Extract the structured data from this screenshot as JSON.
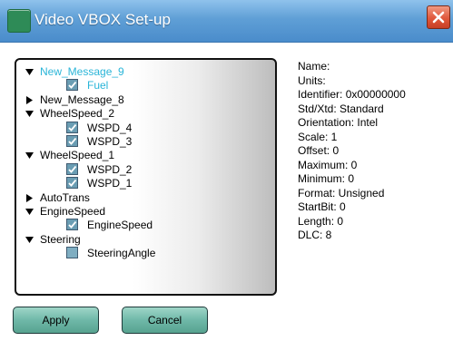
{
  "window": {
    "title": "Video VBOX Set-up"
  },
  "tree": {
    "nodes": [
      {
        "label": "New_Message_9",
        "expanded": true,
        "selected": true,
        "children": [
          {
            "label": "Fuel",
            "checked": true,
            "selected": true
          }
        ]
      },
      {
        "label": "New_Message_8",
        "expanded": false,
        "children": []
      },
      {
        "label": "WheelSpeed_2",
        "expanded": true,
        "children": [
          {
            "label": "WSPD_4",
            "checked": true
          },
          {
            "label": "WSPD_3",
            "checked": true
          }
        ]
      },
      {
        "label": "WheelSpeed_1",
        "expanded": true,
        "children": [
          {
            "label": "WSPD_2",
            "checked": true
          },
          {
            "label": "WSPD_1",
            "checked": true
          }
        ]
      },
      {
        "label": "AutoTrans",
        "expanded": false,
        "children": []
      },
      {
        "label": "EngineSpeed",
        "expanded": true,
        "children": [
          {
            "label": "EngineSpeed",
            "checked": true
          }
        ]
      },
      {
        "label": "Steering",
        "expanded": true,
        "children": [
          {
            "label": "SteeringAngle",
            "checked": false
          }
        ]
      }
    ]
  },
  "properties": [
    "Name:",
    "Units:",
    "Identifier:  0x00000000",
    "Std/Xtd:  Standard",
    "Orientation:  Intel",
    "Scale:  1",
    "Offset:  0",
    "Maximum:  0",
    "Minimum:  0",
    "Format:  Unsigned",
    "StartBit:  0",
    "Length:  0",
    "DLC:  8"
  ],
  "buttons": {
    "apply": "Apply",
    "cancel": "Cancel"
  },
  "colors": {
    "selected_text": "#2ab5d8",
    "titlebar": "#5f9fd6",
    "button": "#6fb8a8",
    "close": "#e0583c"
  },
  "icons": {
    "app": "vbox-app-icon",
    "close": "close-icon",
    "expanded": "triangle-down-icon",
    "collapsed": "triangle-right-icon",
    "check": "checkmark-icon"
  }
}
